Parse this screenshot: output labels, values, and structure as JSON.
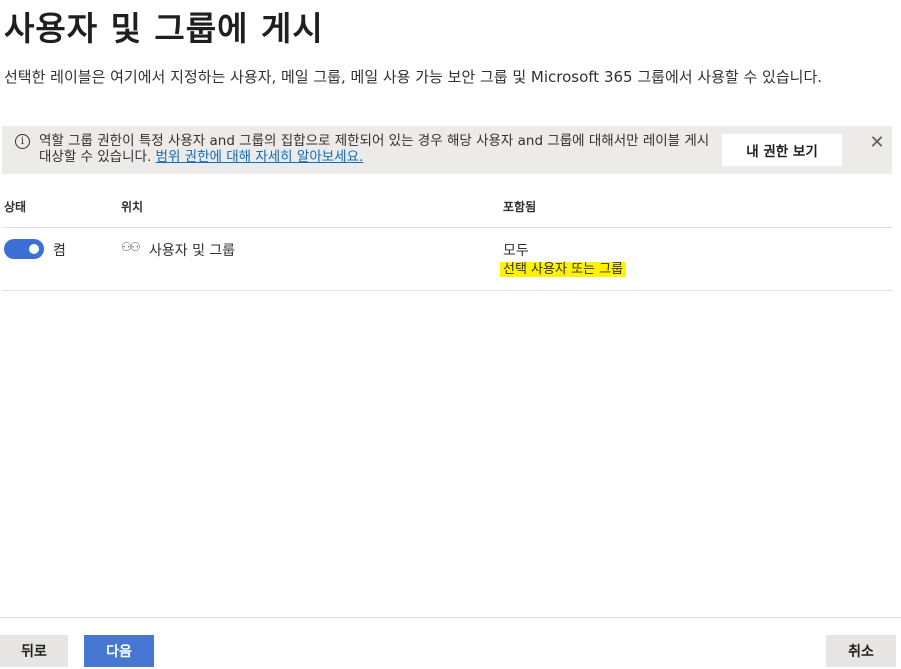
{
  "page": {
    "title": "사용자 및 그룹에 게시",
    "description": "선택한 레이블은 여기에서 지정하는 사용자, 메일 그룹, 메일 사용 가능 보안 그룹 및 Microsoft 365 그룹에서 사용할 수 있습니다."
  },
  "banner": {
    "message": "역할 그룹 권한이 특정 사용자 and 그룹의 집합으로 제한되어 있는 경우 해당 사용자 and 그룹에 대해서만 레이블 게시 대상할 수 있습니다.",
    "link": "범위 권한에 대해 자세히 알아보세요.",
    "button": "내 권한 보기",
    "close_glyph": "✕"
  },
  "table": {
    "headers": {
      "status": "상태",
      "location": "위치",
      "included": "포함됨"
    },
    "rows": [
      {
        "status_label": "켬",
        "status_on": true,
        "location_icon": "group-icon",
        "location": "사용자 및 그룹",
        "included_value": "모두",
        "included_link": "선택 사용자 또는 그룹"
      }
    ]
  },
  "footer": {
    "back": "뒤로",
    "next": "다음",
    "cancel": "취소"
  },
  "colors": {
    "accent": "#3b6fd4",
    "highlight": "#fff200",
    "link": "#0f6cbd"
  }
}
